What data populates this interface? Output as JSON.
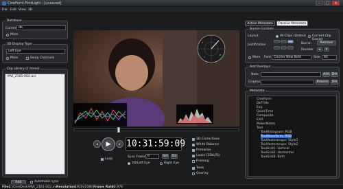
{
  "window": {
    "title": "CineForm FirstLight - [unsaved]",
    "min": "–",
    "max": "□",
    "close": "×"
  },
  "menu": [
    "File",
    "Edit",
    "View",
    "3D"
  ],
  "database": {
    "label": "Database",
    "current_label": "Current",
    "current_value": "db",
    "more_label": "More"
  },
  "display_type": {
    "label": "3D Display Type",
    "value": "Left Eye",
    "more_label": "More",
    "swap_label": "Swap Channels"
  },
  "clip_library": {
    "label": "Clip Library (1 items)",
    "items": [
      "MVI_2181-002.avi"
    ],
    "add_button": "Add Scan",
    "auto_sync_label": "Automatic sync"
  },
  "tabs": [
    "Active Metadata",
    "Passive Metadata"
  ],
  "burnin": {
    "label": "Burnin Controls",
    "layout_label": "Layout",
    "all_clips_label": "All Clips (Global)",
    "current_clip_label": "Current Clip (Local)",
    "justification_label": "Justification",
    "burnin_label": "Burnin",
    "remove_button": "Remove",
    "reorder_label": "Reorder",
    "more_label": "More",
    "font_label": "Font",
    "font_value": "Courier New Bold",
    "size_label": "Size",
    "size_value": "60"
  },
  "overlays": {
    "label": "Add Overlays",
    "note_label": "Note",
    "graphic_label": "Graphic",
    "add_button": "Add",
    "del_button": "Del",
    "browse_button": "Browse"
  },
  "metadata": {
    "label": "Metadata",
    "tree": [
      "CineForm",
      "DefTitle",
      "Exp",
      "QuickTime",
      "Composite",
      "EXIF",
      "MakerNotes",
      "Tool",
      "ToolHistogram: RGB",
      "ToolWaveform: RGB",
      "ToolVectorscope: Style1",
      "ToolVectorscope: Style2",
      "ToolGrid1: Vertical",
      "ToolGrid2: Horizontal",
      "ToolGrid3: Both"
    ],
    "selected_index": 9
  },
  "playback": {
    "timecode": "10:31:59:09",
    "loop_label": "Loop",
    "sync_frame_label": "Sync Frame",
    "sync_frame_value": "0",
    "set_button": "Set",
    "go_button": "Go",
    "left_eye_label": "2D/Left Eye",
    "right_eye_label": "Right Eye"
  },
  "checks": [
    "3D Corrections",
    "White Balance",
    "Primaries",
    "Looks (3DLUTs)",
    "Framing",
    "Tools",
    "Overlay"
  ],
  "status": {
    "file_label": "File:",
    "file_value": "E:\\CineDesk\\MVI_2181-002.avi",
    "res_label": "Resolution:",
    "res_value": "1920x1080",
    "rate_label": "Frame Rate:",
    "rate_value": "23.976"
  }
}
